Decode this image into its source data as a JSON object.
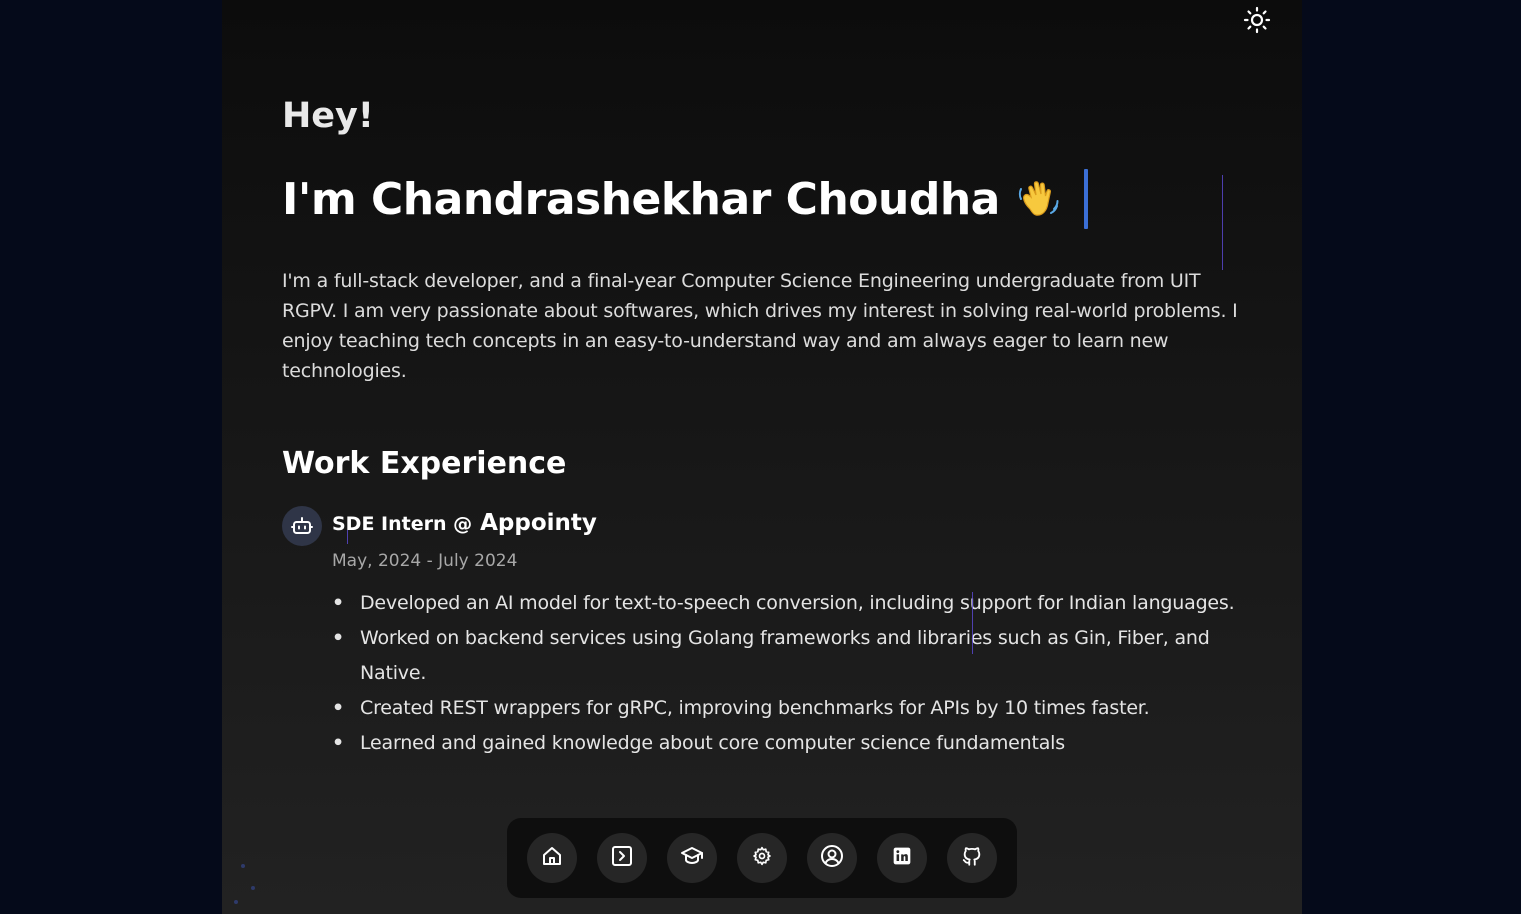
{
  "colors": {
    "page_background": "#050a1a",
    "panel_background": "#121212",
    "accent_cursor": "#3b6fd6",
    "dock_background": "#0e0e0e"
  },
  "header": {
    "theme_toggle_icon": "sun-icon"
  },
  "hero": {
    "greeting": "Hey!",
    "name": "I'm Chandrashekhar Choudha",
    "wave_icon": "waving-hand-icon",
    "intro": "I'm a full-stack developer, and a final-year Computer Science Engineering undergraduate from UIT RGPV. I am very passionate about softwares, which drives my interest in solving real-world problems. I enjoy teaching tech concepts in an easy-to-understand way and am always eager to learn new technologies."
  },
  "work": {
    "title": "Work Experience",
    "items": [
      {
        "icon": "robot-icon",
        "role": "SDE Intern @",
        "company": "Appointy",
        "date": "May, 2024 - July 2024",
        "bullets": [
          "Developed an AI model for text-to-speech conversion, including support for Indian languages.",
          "Worked on backend services using Golang frameworks and libraries such as Gin, Fiber, and Native.",
          "Created REST wrappers for gRPC, improving benchmarks for APIs by 10 times faster.",
          "Learned and gained knowledge about core computer science fundamentals"
        ]
      }
    ]
  },
  "dock": {
    "items": [
      "home-icon",
      "terminal-icon",
      "graduation-cap-icon",
      "gear-icon",
      "user-circle-icon",
      "linkedin-icon",
      "github-icon"
    ]
  }
}
